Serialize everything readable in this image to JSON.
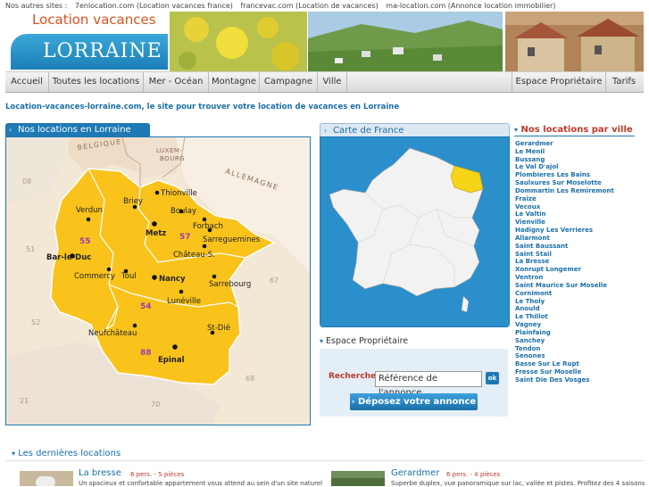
{
  "topbar": {
    "label": "Nos autres sites :",
    "sites": [
      "7enlocation.com (Location vacances france)",
      "francevac.com (Location de vacances)",
      "ma-location.com (Annonce location immobilier)"
    ]
  },
  "logo": {
    "top": "Location vacances",
    "region": "LORRAINE"
  },
  "nav": {
    "items": [
      "Accueil",
      "Toutes les locations",
      "Mer - Océan",
      "Montagne",
      "Campagne",
      "Ville"
    ],
    "right_items": [
      "Espace Propriétaire",
      "Tarifs"
    ]
  },
  "tagline": "Location-vacances-lorraine.com, le site pour trouver votre location de vacances en Lorraine",
  "map_panel": {
    "title": "Nos locations en Lorraine",
    "countries": [
      "BELGIQUE",
      "LUXEM-",
      "BOURG",
      "ALLEMAGNE"
    ],
    "cities": [
      "Thionville",
      "Briey",
      "Verdun",
      "Boulay",
      "Metz",
      "Forbach",
      "Sarreguemines",
      "Château-S.",
      "Bar-le-Duc",
      "Commercy",
      "Toul",
      "Nancy",
      "Sarrebourg",
      "Lunéville",
      "Neufchâteau",
      "St-Dié",
      "Epinal"
    ],
    "departments": [
      "55",
      "57",
      "54",
      "88"
    ],
    "neighbors": [
      "08",
      "51",
      "52",
      "67",
      "68",
      "70",
      "21"
    ]
  },
  "france_panel": {
    "title": "Carte de France",
    "highlight_color": "#f6d417"
  },
  "owner": {
    "title": "Espace Propriétaire",
    "search_label": "Rechercher",
    "search_value": "Référence de l'annonce",
    "ok_label": "ok",
    "deposit_label": "Déposez votre annonce"
  },
  "villes": {
    "title": "Nos locations par ville",
    "items": [
      "Gerardmer",
      "Le Menil",
      "Bussang",
      "Le Val D'ajol",
      "Plombieres Les Bains",
      "Saulxures Sur Moselotte",
      "Dommartin Les Remiremont",
      "Fraize",
      "Vecoux",
      "Le Valtin",
      "Vienville",
      "Hadigny Les Verrieres",
      "Allarmont",
      "Saint Baussant",
      "Saint Stail",
      "La Bresse",
      "Xonrupt Longemer",
      "Ventron",
      "Saint Maurice Sur Moselle",
      "Cornimont",
      "Le Tholy",
      "Anould",
      "Le Thillot",
      "Vagney",
      "Plainfaing",
      "Sanchey",
      "Tendon",
      "Senones",
      "Basse Sur Le Rupt",
      "Fresse Sur Moselle",
      "Saint Die Des Vosges"
    ]
  },
  "dernieres": {
    "title": "Les dernières locations",
    "listings": [
      {
        "city": "La bresse",
        "meta": "6 pers. - 5 pièces",
        "desc": "Un spacieux et confortable appartement vous attend au sein d'un site naturel"
      },
      {
        "city": "Gerardmer",
        "meta": "6 pers. - 4 pièces",
        "desc": "Superbe duplex, vue panoramique sur lac, vallée et pistes. Profitez des 4 saisons"
      }
    ]
  }
}
